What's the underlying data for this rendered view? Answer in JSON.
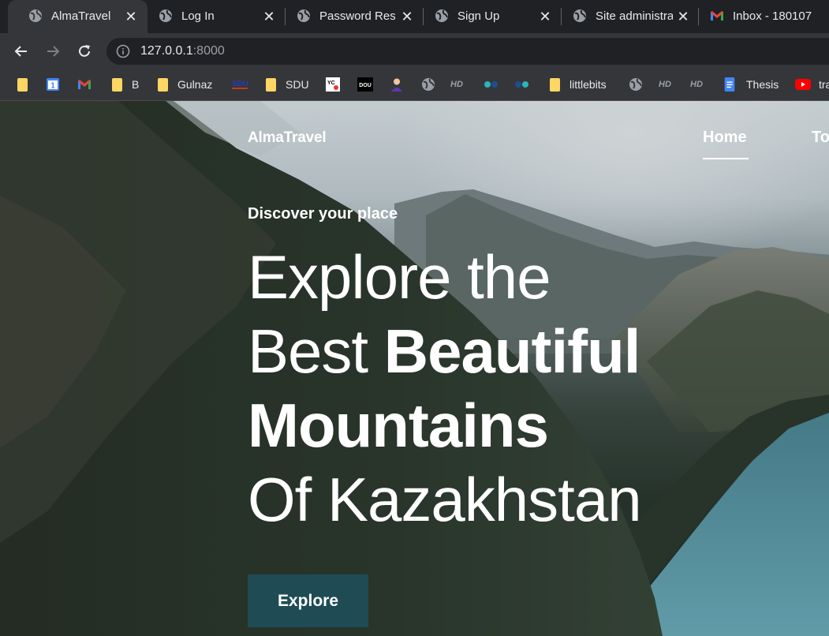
{
  "browser": {
    "tabs": [
      {
        "title": "AlmaTravel",
        "icon": "globe-icon",
        "active": true
      },
      {
        "title": "Log In",
        "icon": "globe-icon"
      },
      {
        "title": "Password Reset",
        "icon": "globe-icon"
      },
      {
        "title": "Sign Up",
        "icon": "globe-icon"
      },
      {
        "title": "Site administration",
        "icon": "globe-icon"
      },
      {
        "title": "Inbox - 180107",
        "icon": "gmail-icon"
      }
    ],
    "url_host": "127.0.0.1",
    "url_port": ":8000",
    "bookmarks": [
      {
        "label": "",
        "icon": "folder-icon"
      },
      {
        "label": "",
        "icon": "calendar-icon"
      },
      {
        "label": "",
        "icon": "gmail-icon"
      },
      {
        "label": "B",
        "icon": "folder-icon"
      },
      {
        "label": "Gulnaz",
        "icon": "folder-icon"
      },
      {
        "label": "",
        "icon": "sdu-logo-icon"
      },
      {
        "label": "SDU",
        "icon": "folder-icon"
      },
      {
        "label": "",
        "icon": "yc-icon"
      },
      {
        "label": "",
        "icon": "dou-icon"
      },
      {
        "label": "",
        "icon": "avatar-icon"
      },
      {
        "label": "",
        "icon": "globe-icon"
      },
      {
        "label": "",
        "icon": "hd-icon"
      },
      {
        "label": "",
        "icon": "dots-icon"
      },
      {
        "label": "",
        "icon": "dots-icon"
      },
      {
        "label": "littlebits",
        "icon": "folder-icon"
      },
      {
        "label": "",
        "icon": "globe-icon"
      },
      {
        "label": "",
        "icon": "hd-icon"
      },
      {
        "label": "",
        "icon": "hd-icon"
      },
      {
        "label": "Thesis",
        "icon": "docs-icon"
      },
      {
        "label": "tra",
        "icon": "youtube-icon"
      }
    ],
    "hd_text": "HD"
  },
  "site": {
    "brand": "AlmaTravel",
    "nav": [
      {
        "label": "Home",
        "active": true
      },
      {
        "label": "To"
      }
    ],
    "hero": {
      "tagline": "Discover your place",
      "line1": "Explore the",
      "line2_regular": "Best ",
      "line2_bold": "Beautiful",
      "line3_bold": "Mountains",
      "line4": "Of Kazakhstan",
      "button": "Explore"
    }
  },
  "colors": {
    "tab_active": "#35363a",
    "tabstrip": "#202124",
    "button_bg": "#1f4b55",
    "folder": "#fdd663"
  }
}
